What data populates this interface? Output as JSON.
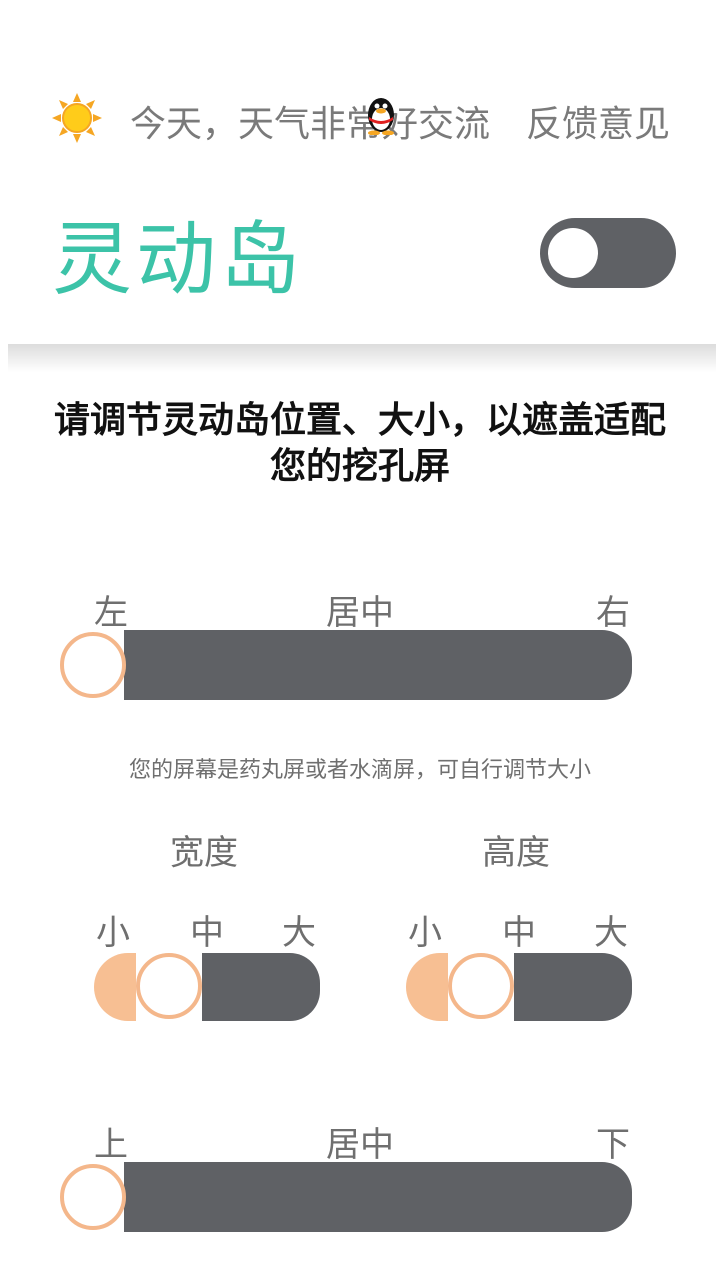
{
  "header": {
    "weather_text": "今天，天气非常好",
    "chat_text": "交流",
    "feedback": "反馈意见"
  },
  "title": "灵动岛",
  "toggle": {
    "on": false
  },
  "instruction": "请调节灵动岛位置、大小，以遮盖适配您的挖孔屏",
  "horizontal": {
    "left": "左",
    "center": "居中",
    "right": "右"
  },
  "hint": "您的屏幕是药丸屏或者水滴屏，可自行调节大小",
  "width": {
    "title": "宽度",
    "small": "小",
    "mid": "中",
    "large": "大"
  },
  "height": {
    "title": "高度",
    "small": "小",
    "mid": "中",
    "large": "大"
  },
  "vertical": {
    "top": "上",
    "center": "居中",
    "bottom": "下"
  },
  "colors": {
    "accent": "#3cc3a8",
    "track": "#5f6165",
    "knob_border": "#f4b78b"
  }
}
